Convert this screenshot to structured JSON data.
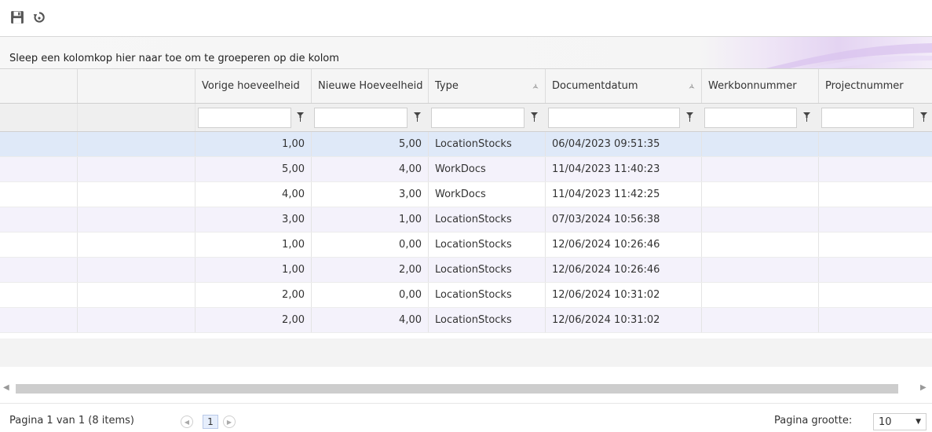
{
  "toolbar": {
    "icons": [
      "save-icon",
      "refresh-icon"
    ]
  },
  "group_panel": {
    "text": "Sleep een kolomkop hier naar toe om te groeperen op die kolom"
  },
  "grid": {
    "columns": [
      {
        "label": ""
      },
      {
        "label": ""
      },
      {
        "label": "Vorige hoeveelheid"
      },
      {
        "label": "Nieuwe Hoeveelheid"
      },
      {
        "label": "Type"
      },
      {
        "label": "Documentdatum"
      },
      {
        "label": "Werkbonnummer"
      },
      {
        "label": "Projectnummer"
      }
    ],
    "filter_values": [
      "",
      "",
      "",
      "",
      "",
      ""
    ],
    "rows": [
      {
        "vorige": "1,00",
        "nieuwe": "5,00",
        "type": "LocationStocks",
        "datum": "06/04/2023 09:51:35",
        "werkbon": "",
        "project": ""
      },
      {
        "vorige": "5,00",
        "nieuwe": "4,00",
        "type": "WorkDocs",
        "datum": "11/04/2023 11:40:23",
        "werkbon": "",
        "project": ""
      },
      {
        "vorige": "4,00",
        "nieuwe": "3,00",
        "type": "WorkDocs",
        "datum": "11/04/2023 11:42:25",
        "werkbon": "",
        "project": ""
      },
      {
        "vorige": "3,00",
        "nieuwe": "1,00",
        "type": "LocationStocks",
        "datum": "07/03/2024 10:56:38",
        "werkbon": "",
        "project": ""
      },
      {
        "vorige": "1,00",
        "nieuwe": "0,00",
        "type": "LocationStocks",
        "datum": "12/06/2024 10:26:46",
        "werkbon": "",
        "project": ""
      },
      {
        "vorige": "1,00",
        "nieuwe": "2,00",
        "type": "LocationStocks",
        "datum": "12/06/2024 10:26:46",
        "werkbon": "",
        "project": ""
      },
      {
        "vorige": "2,00",
        "nieuwe": "0,00",
        "type": "LocationStocks",
        "datum": "12/06/2024 10:31:02",
        "werkbon": "",
        "project": ""
      },
      {
        "vorige": "2,00",
        "nieuwe": "4,00",
        "type": "LocationStocks",
        "datum": "12/06/2024 10:31:02",
        "werkbon": "",
        "project": ""
      }
    ],
    "selected_row": 0
  },
  "pager": {
    "info": "Pagina 1 van 1 (8 items)",
    "current_page": "1",
    "page_size_label": "Pagina grootte:",
    "page_size_value": "10"
  },
  "colors": {
    "selected_row": "#dfe9f8",
    "alt_row": "#f4f2fb",
    "header_bg": "#f5f5f5"
  }
}
